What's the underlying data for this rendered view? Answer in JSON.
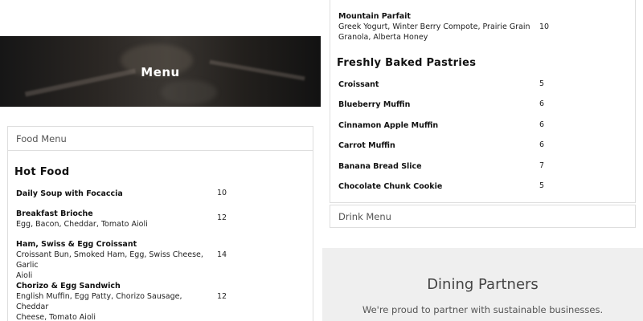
{
  "hero": {
    "title": "Menu"
  },
  "food_menu": {
    "header": "Food Menu",
    "section_title": "Hot Food",
    "items": [
      {
        "name": "Daily Soup with Focaccia",
        "desc_line1": "",
        "desc_line2": "",
        "price": "10"
      },
      {
        "name": "Breakfast Brioche",
        "desc_line1": "Egg, Bacon, Cheddar, Tomato Aioli",
        "desc_line2": "",
        "price": "12"
      },
      {
        "name": "Ham, Swiss & Egg Croissant",
        "desc_line1": "Croissant Bun, Smoked Ham, Egg, Swiss Cheese, Garlic",
        "desc_line2": "Aioli",
        "price": "14"
      },
      {
        "name": "Chorizo & Egg Sandwich",
        "desc_line1": "English Muffin, Egg Patty, Chorizo Sausage, Cheddar",
        "desc_line2": "Cheese, Tomato Aioli",
        "price": "12"
      }
    ]
  },
  "pastry_menu": {
    "top_item": {
      "name": "Mountain Parfait",
      "desc_line1": "Greek Yogurt, Winter Berry Compote, Prairie Grain",
      "desc_line2": "Granola, Alberta Honey",
      "price": "10"
    },
    "section_title": "Freshly Baked Pastries",
    "items": [
      {
        "name": "Croissant",
        "price": "5"
      },
      {
        "name": "Blueberry Muffin",
        "price": "6"
      },
      {
        "name": "Cinnamon Apple Muffin",
        "price": "6"
      },
      {
        "name": "Carrot Muffin",
        "price": "6"
      },
      {
        "name": "Banana Bread Slice",
        "price": "7"
      },
      {
        "name": "Chocolate Chunk Cookie",
        "price": "5"
      }
    ]
  },
  "drink_menu": {
    "header": "Drink Menu"
  },
  "partners": {
    "title": "Dining Partners",
    "subtitle": "We're proud to partner with sustainable businesses."
  }
}
